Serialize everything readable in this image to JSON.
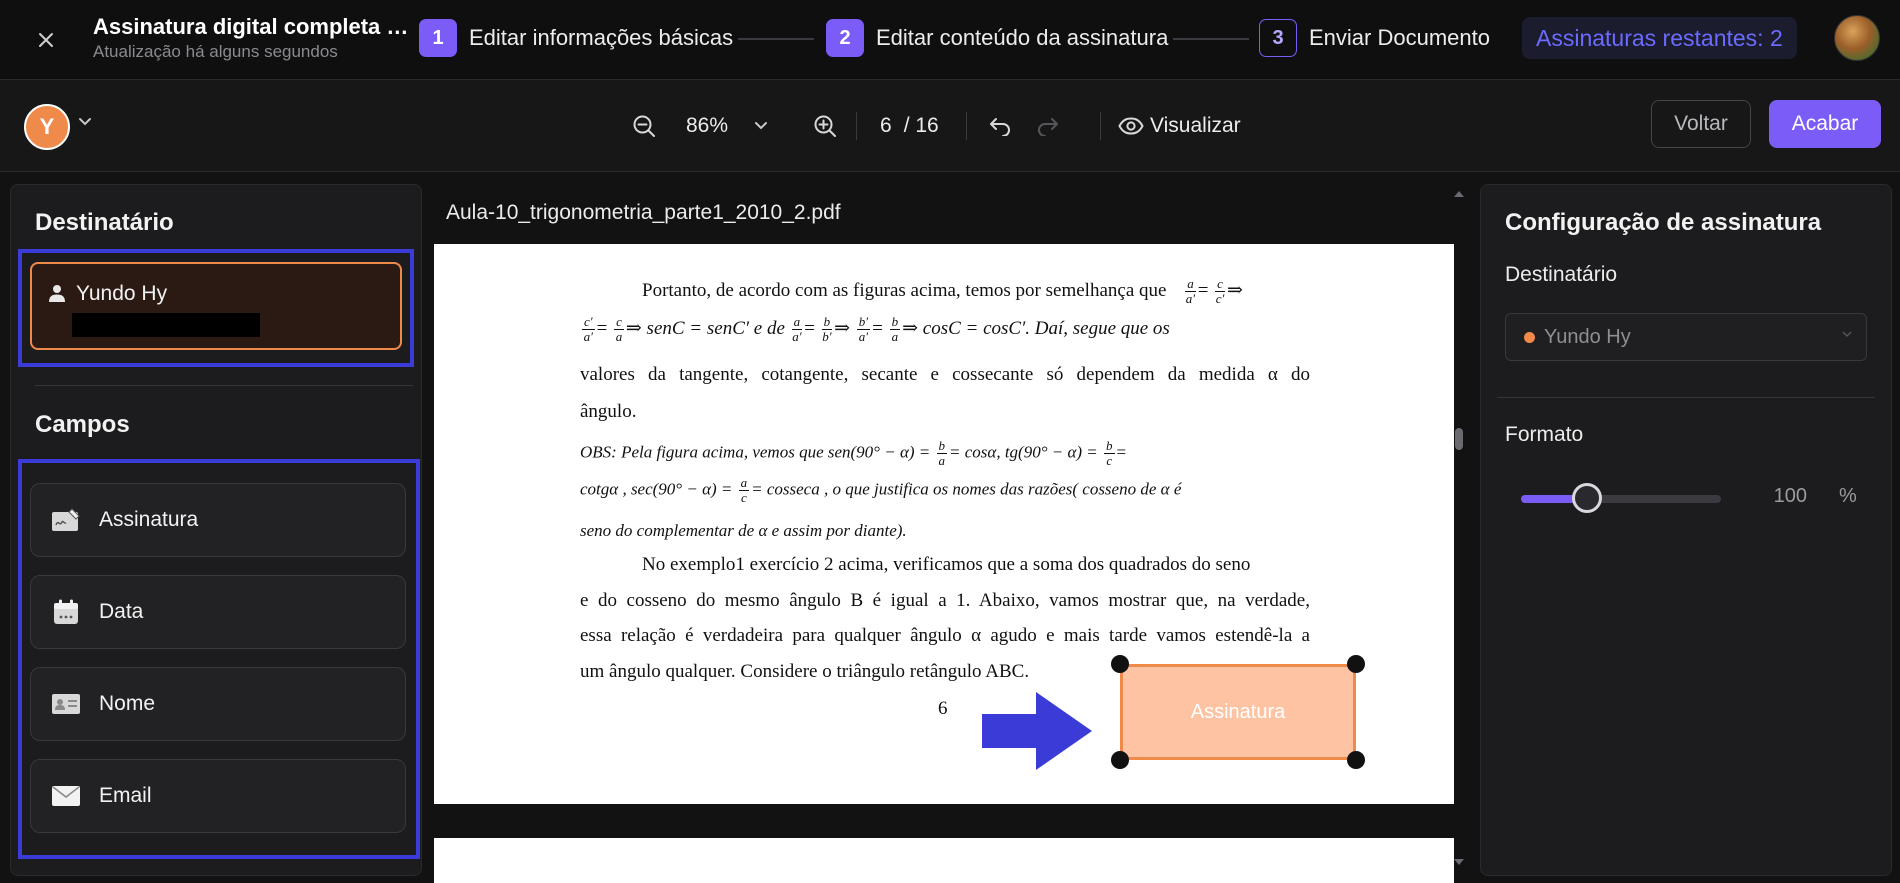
{
  "header": {
    "title": "Assinatura digital completa com...",
    "subtitle": "Atualização há alguns segundos",
    "steps": [
      {
        "num": "1",
        "label": "Editar informações básicas"
      },
      {
        "num": "2",
        "label": "Editar conteúdo da assinatura"
      },
      {
        "num": "3",
        "label": "Enviar Documento"
      }
    ],
    "remaining": "Assinaturas restantes: 2"
  },
  "toolbar": {
    "avatar_initial": "Y",
    "zoom": "86%",
    "page_current": "6",
    "page_total": "/ 16",
    "preview_label": "Visualizar",
    "back_label": "Voltar",
    "finish_label": "Acabar"
  },
  "left": {
    "recipient_heading": "Destinatário",
    "recipient_name": "Yundo Hy",
    "fields_heading": "Campos",
    "fields": [
      {
        "label": "Assinatura",
        "icon": "signature-icon"
      },
      {
        "label": "Data",
        "icon": "calendar-icon"
      },
      {
        "label": "Nome",
        "icon": "id-card-icon"
      },
      {
        "label": "Email",
        "icon": "envelope-icon"
      }
    ]
  },
  "document": {
    "filename": "Aula-10_trigonometria_parte1_2010_2.pdf",
    "p1_a": "Portanto, de acordo com as figuras acima, temos por semelhança que",
    "p2_b": "⇒ senC = senC′  e     de",
    "p2_c": "⇒ cosC = cosC′. Daí, segue que os",
    "p3": "valores da tangente, cotangente, secante e cossecante só dependem da medida  α do",
    "p4": "ângulo.",
    "obs_a": "OBS:  Pela  figura  acima,  vemos  que  sen(90° − α) =",
    "obs_b": "= cosα,  tg(90° − α) =",
    "obs_c": "cotgα  , sec(90° − α) =",
    "obs_d": "= cosseca , o que justifica os nomes das razões( cosseno de α é",
    "obs_e": "seno do complementar de α e assim por diante).",
    "p5": "No exemplo1 exercício 2 acima, verificamos que a soma dos quadrados do seno",
    "p6": "e do cosseno do mesmo ângulo B é igual a 1. Abaixo, vamos mostrar que, na verdade,",
    "p7": "essa relação é verdadeira para qualquer ângulo α agudo e mais tarde vamos estendê-la a",
    "p8": "um ângulo qualquer. Considere o triângulo retângulo ABC.",
    "page_number": "6",
    "signature_placeholder": "Assinatura"
  },
  "right": {
    "title": "Configuração de assinatura",
    "recipient_label": "Destinatário",
    "recipient_value": "Yundo Hy",
    "format_label": "Formato",
    "format_value": "100",
    "format_unit": "%",
    "format_slider_fraction": 0.33
  },
  "colors": {
    "accent": "#7b5cf6",
    "recipient": "#f08a4b",
    "highlight_outline": "#3b3bd8"
  }
}
